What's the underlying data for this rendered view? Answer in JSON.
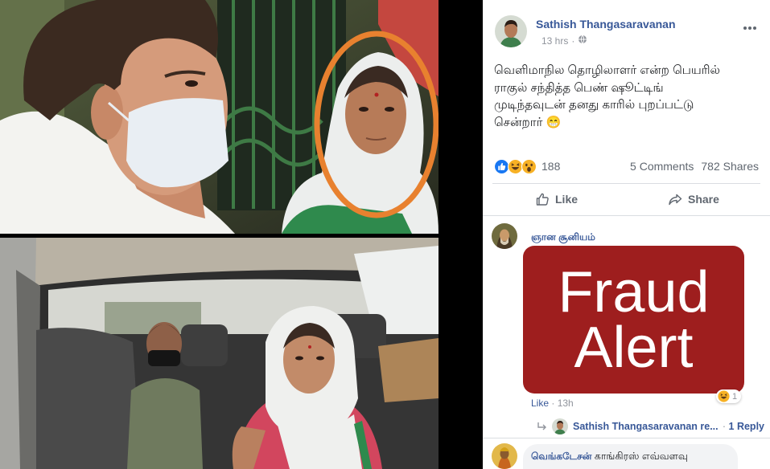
{
  "post": {
    "author": "Sathish Thangasaravanan",
    "timestamp": "13 hrs",
    "meta_separator": "·",
    "privacy_icon": "globe-icon",
    "more_icon": "more-options-icon",
    "text_lines": [
      "வெளிமாநில தொழிலாளர் என்ற பெயரில்",
      "ராகுல் சந்தித்த பெண் ஷூட்டிங்",
      "முடிந்தவுடன் தனது காரில் புறப்பட்டு",
      "சென்றார் 😁"
    ],
    "reaction_icons": [
      "like-reaction-icon",
      "haha-reaction-icon",
      "wow-reaction-icon"
    ],
    "reaction_count": "188",
    "comments_count": "5 Comments",
    "shares_count": "782 Shares",
    "like_label": "Like",
    "share_label": "Share"
  },
  "comments": [
    {
      "author": "ஞான சூனியம்",
      "attachment_lines": [
        "Fraud",
        "Alert"
      ],
      "like_label": "Like",
      "separator": "·",
      "time": "13h",
      "reaction_icon": "haha-reaction-icon",
      "reaction_count": "1",
      "reply_icon": "reply-arrow-icon",
      "reply_author": "Sathish Thangasaravanan re...",
      "reply_separator": "·",
      "reply_count": "1 Reply"
    },
    {
      "author": "வெங்கடேசன்",
      "text": "காங்கிரஸ் எவ்வளவு"
    }
  ],
  "colors": {
    "link_blue": "#385898",
    "secondary_text": "#606770",
    "divider": "#dadde1",
    "fraud_alert_red": "#9e1e1e",
    "highlight_orange": "#e8812f",
    "comment_bubble": "#f2f3f5"
  }
}
